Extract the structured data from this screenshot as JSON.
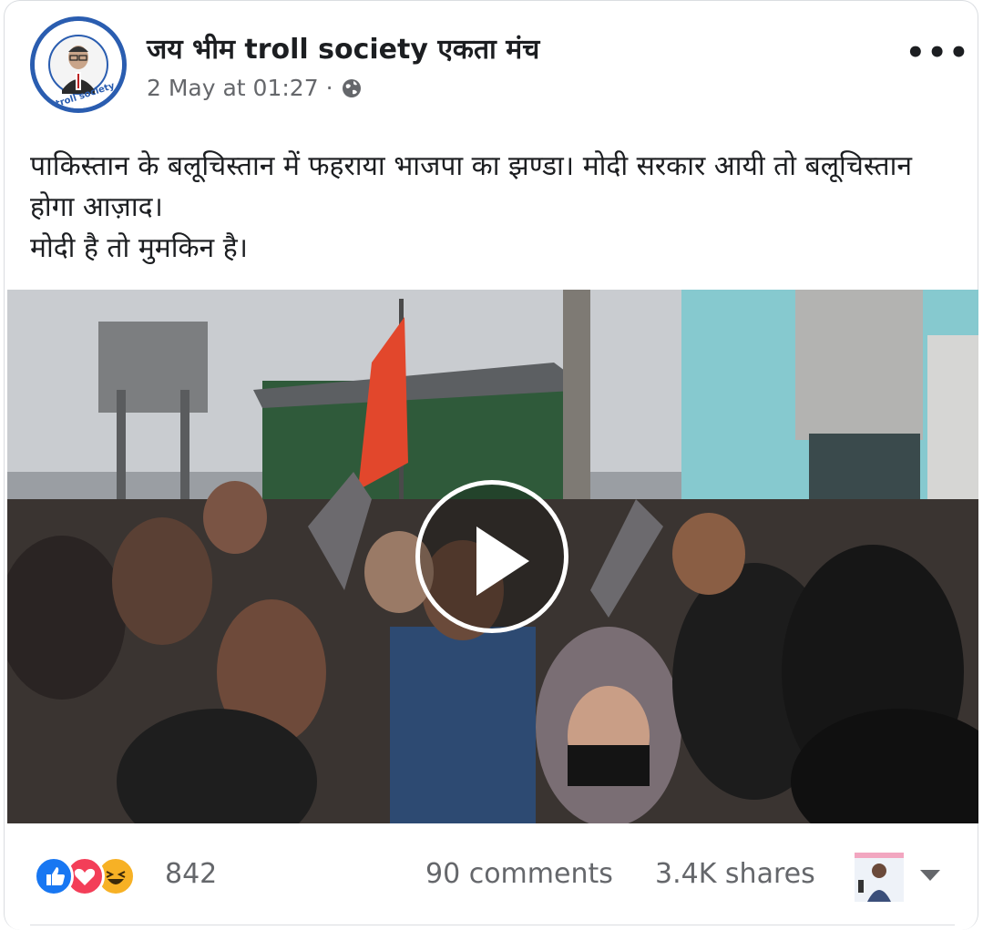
{
  "post": {
    "page_name": "जय भीम troll society एकता मंच",
    "timestamp": "2 May at 01:27",
    "separator": "·",
    "privacy_icon": "globe-icon",
    "more_icon": "more-options-icon",
    "text_lines": [
      "पाकिस्तान के बलूचिस्तान में फहराया भाजपा का झण्डा। मोदी सरकार आयी तो बलूचिस्तान होगा आज़ाद।",
      "मोदी है तो मुमकिन है।"
    ],
    "avatar_text": "troll society",
    "media": {
      "type": "video",
      "play_icon": "play-icon"
    }
  },
  "footer": {
    "reactions": [
      "like",
      "love",
      "haha"
    ],
    "reaction_count": "842",
    "comments": "90 comments",
    "shares": "3.4K shares",
    "dropdown_icon": "chevron-down-icon"
  },
  "colors": {
    "like": "#1877f2",
    "love": "#f33e58",
    "haha": "#f7b125",
    "secondary_text": "#65676b"
  }
}
